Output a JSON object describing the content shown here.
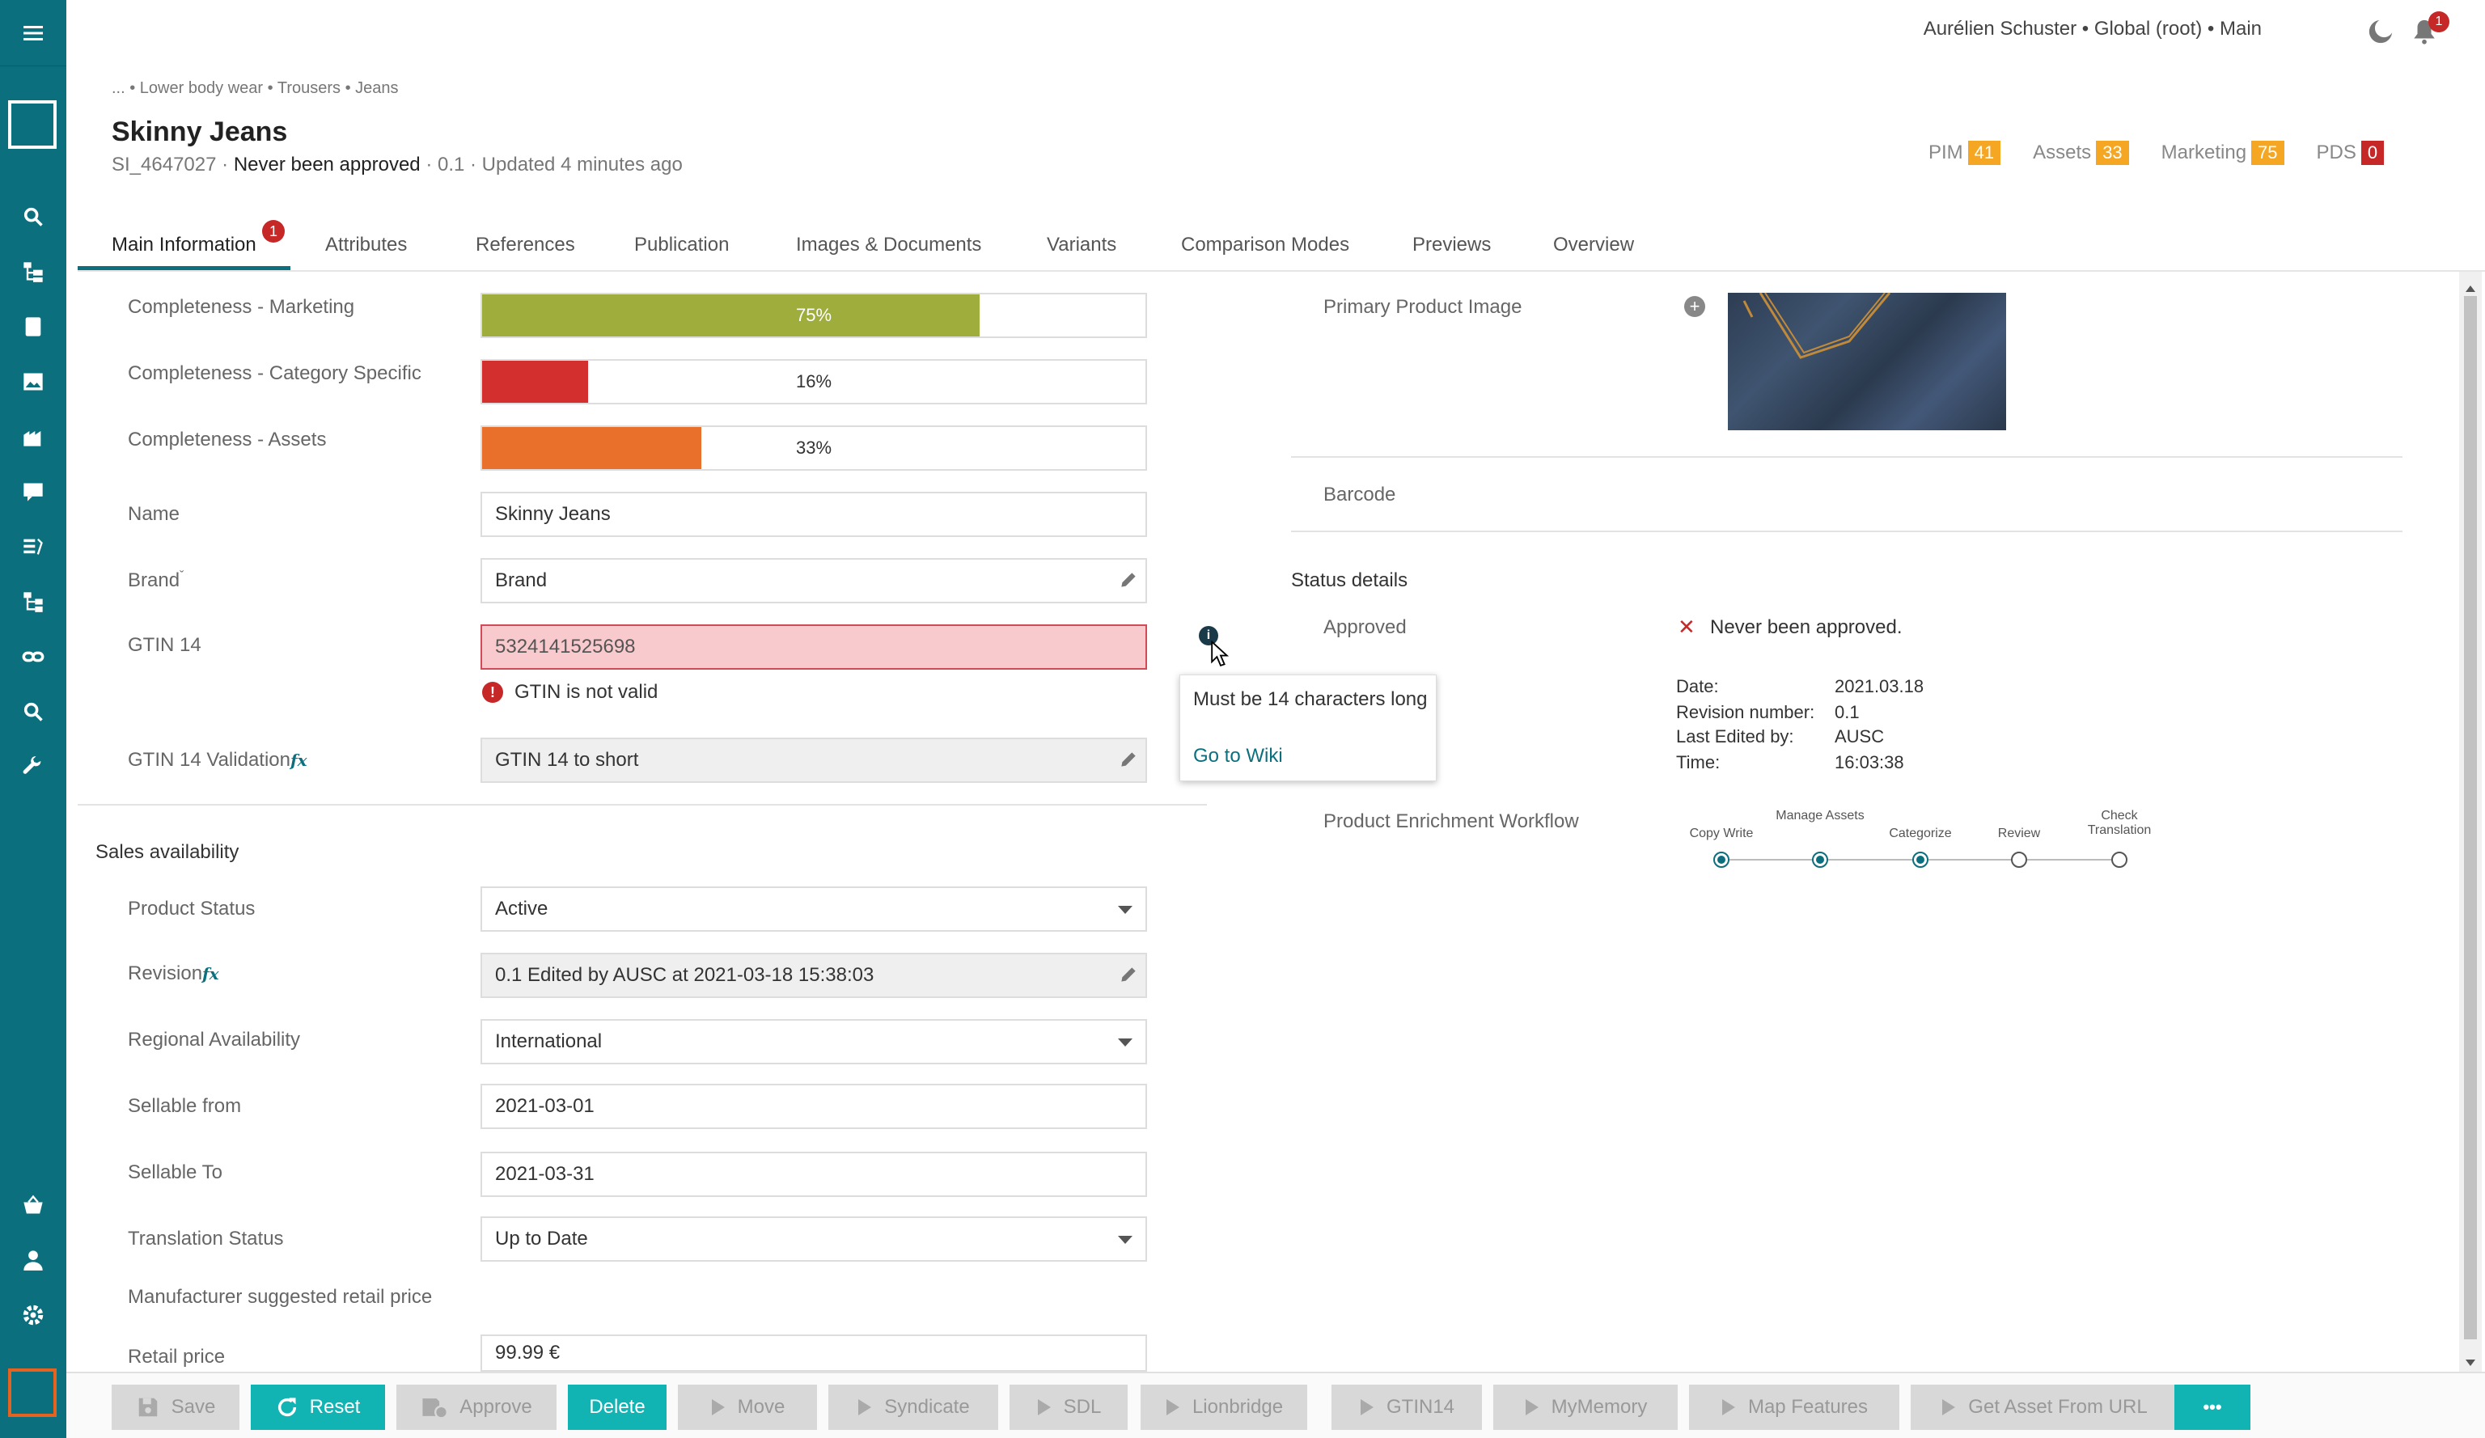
{
  "header": {
    "user_info": "Aurélien Schuster • Global (root) • Main",
    "notification_count": "1"
  },
  "breadcrumb": "... • Lower body wear • Trousers • Jeans",
  "product": {
    "title": "Skinny Jeans",
    "id": "SI_4647027",
    "approval": "Never been approved",
    "version_updated": "· 0.1 · Updated 4 minutes ago"
  },
  "scores": [
    {
      "label": "PIM",
      "value": "41",
      "color": "#f5a623"
    },
    {
      "label": "Assets",
      "value": "33",
      "color": "#f5a623"
    },
    {
      "label": "Marketing",
      "value": "75",
      "color": "#f5a623"
    },
    {
      "label": "PDS",
      "value": "0",
      "color": "#c62828"
    }
  ],
  "tabs": [
    {
      "label": "Main Information",
      "badge": "1"
    },
    {
      "label": "Attributes"
    },
    {
      "label": "References"
    },
    {
      "label": "Publication"
    },
    {
      "label": "Images & Documents"
    },
    {
      "label": "Variants"
    },
    {
      "label": "Comparison Modes"
    },
    {
      "label": "Previews"
    },
    {
      "label": "Overview"
    }
  ],
  "completeness": [
    {
      "label": "Completeness - Marketing",
      "percent": 75,
      "text": "75%",
      "color": "#9fad3d"
    },
    {
      "label": "Completeness - Category Specific",
      "percent": 16,
      "text": "16%",
      "color": "#d32f2f"
    },
    {
      "label": "Completeness - Assets",
      "percent": 33,
      "text": "33%",
      "color": "#e8702a"
    }
  ],
  "fields": {
    "name_label": "Name",
    "name_value": "Skinny Jeans",
    "brand_label": "Brand",
    "brand_value": "Brand",
    "gtin_label": "GTIN 14",
    "gtin_value": "5324141525698",
    "gtin_error": "GTIN is not valid",
    "gtin_val_label": "GTIN 14 Validation",
    "gtin_val_value": "GTIN 14 to short",
    "fx": "fx"
  },
  "tooltip": {
    "message": "Must be 14 characters long",
    "link": "Go to Wiki"
  },
  "sales": {
    "title": "Sales availability",
    "product_status_label": "Product Status",
    "product_status_value": "Active",
    "revision_label": "Revision",
    "revision_value": "0.1 Edited by AUSC at 2021-03-18 15:38:03",
    "regional_label": "Regional Availability",
    "regional_value": "International",
    "sellable_from_label": "Sellable from",
    "sellable_from_value": "2021-03-01",
    "sellable_to_label": "Sellable To",
    "sellable_to_value": "2021-03-31",
    "translation_label": "Translation Status",
    "translation_value": "Up to Date",
    "msrp_label": "Manufacturer suggested retail price",
    "retail_label": "Retail price",
    "retail_value": "99.99 €"
  },
  "right": {
    "primary_image_label": "Primary Product Image",
    "barcode_label": "Barcode",
    "status_details": "Status details",
    "approved_label": "Approved",
    "approved_value": "Never been approved.",
    "details": [
      {
        "k": "Date:",
        "v": "2021.03.18"
      },
      {
        "k": "Revision number:",
        "v": "0.1"
      },
      {
        "k": "Last Edited by:",
        "v": "AUSC"
      },
      {
        "k": "Time:",
        "v": "16:03:38"
      }
    ],
    "workflow_label": "Product Enrichment Workflow",
    "workflow_steps": [
      {
        "label": "Copy Write",
        "done": true
      },
      {
        "label": "Manage Assets",
        "done": true
      },
      {
        "label": "Categorize",
        "done": true
      },
      {
        "label": "Review",
        "done": false
      },
      {
        "label": "Check Translation",
        "done": false
      }
    ]
  },
  "toolbar": {
    "save": "Save",
    "reset": "Reset",
    "approve": "Approve",
    "delete": "Delete",
    "move": "Move",
    "syndicate": "Syndicate",
    "sdl": "SDL",
    "lionbridge": "Lionbridge",
    "gtin14": "GTIN14",
    "mymemory": "MyMemory",
    "map_features": "Map Features",
    "get_asset": "Get Asset From URL",
    "more": "•••"
  }
}
